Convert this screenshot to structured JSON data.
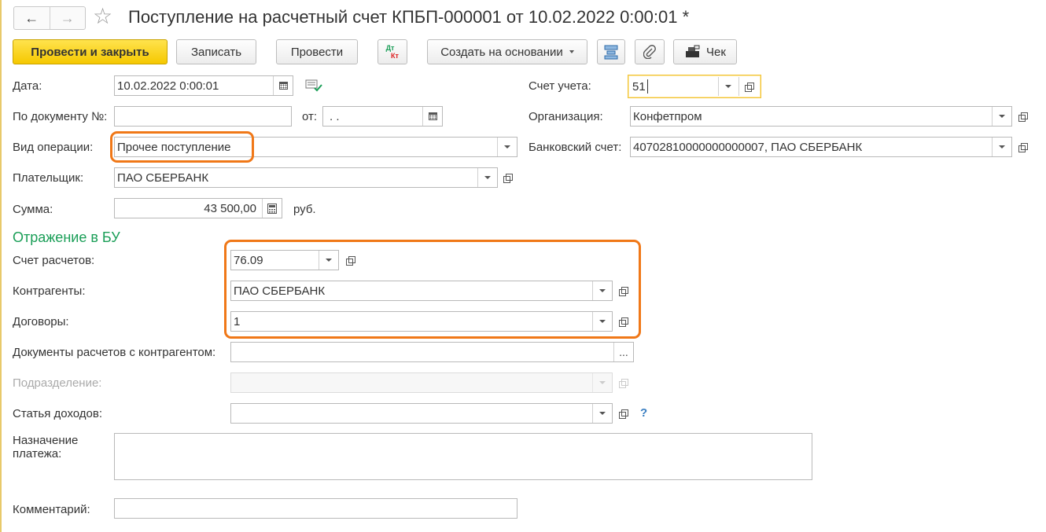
{
  "window": {
    "title": "Поступление на расчетный счет КПБП-000001 от 10.02.2022 0:00:01 *"
  },
  "nav": {
    "back": "←",
    "forward": "→",
    "favorite": "☆"
  },
  "toolbar": {
    "post_and_close": "Провести и закрыть",
    "save": "Записать",
    "post": "Провести",
    "dtkt_top": "Дт",
    "dtkt_bottom": "Кт",
    "create_based_on": "Создать на основании",
    "receipt": "Чек"
  },
  "form": {
    "date": {
      "label": "Дата:",
      "value": "10.02.2022  0:00:01"
    },
    "doc_number": {
      "label": "По документу №:",
      "value": "",
      "from_label": "от:",
      "from_value": " .  ."
    },
    "operation_type": {
      "label": "Вид операции:",
      "value": "Прочее поступление"
    },
    "payer": {
      "label": "Плательщик:",
      "value": "ПАО СБЕРБАНК"
    },
    "amount": {
      "label": "Сумма:",
      "value": "43 500,00",
      "currency": "руб."
    },
    "account": {
      "label": "Счет учета:",
      "value": "51"
    },
    "organization": {
      "label": "Организация:",
      "value": "Конфетпром"
    },
    "bank_account": {
      "label": "Банковский счет:",
      "value": "40702810000000000007, ПАО СБЕРБАНК"
    }
  },
  "accounting": {
    "section_title": "Отражение в БУ",
    "settlement_account": {
      "label": "Счет расчетов:",
      "value": "76.09"
    },
    "counterparties": {
      "label": "Контрагенты:",
      "value": "ПАО СБЕРБАНК"
    },
    "contracts": {
      "label": "Договоры:",
      "value": "1"
    },
    "settlement_docs": {
      "label": "Документы расчетов с контрагентом:",
      "value": "",
      "button": "..."
    },
    "department": {
      "label": "Подразделение:",
      "value": ""
    },
    "income_item": {
      "label": "Статья доходов:",
      "value": "",
      "help": "?"
    }
  },
  "payment_purpose": {
    "label_line1": "Назначение",
    "label_line2": "платежа:",
    "value": ""
  },
  "comment": {
    "label": "Комментарий:",
    "value": ""
  },
  "colors": {
    "accent": "#f5c800",
    "highlight": "#f07818",
    "section": "#1a9e57",
    "help": "#3a7fc2"
  }
}
